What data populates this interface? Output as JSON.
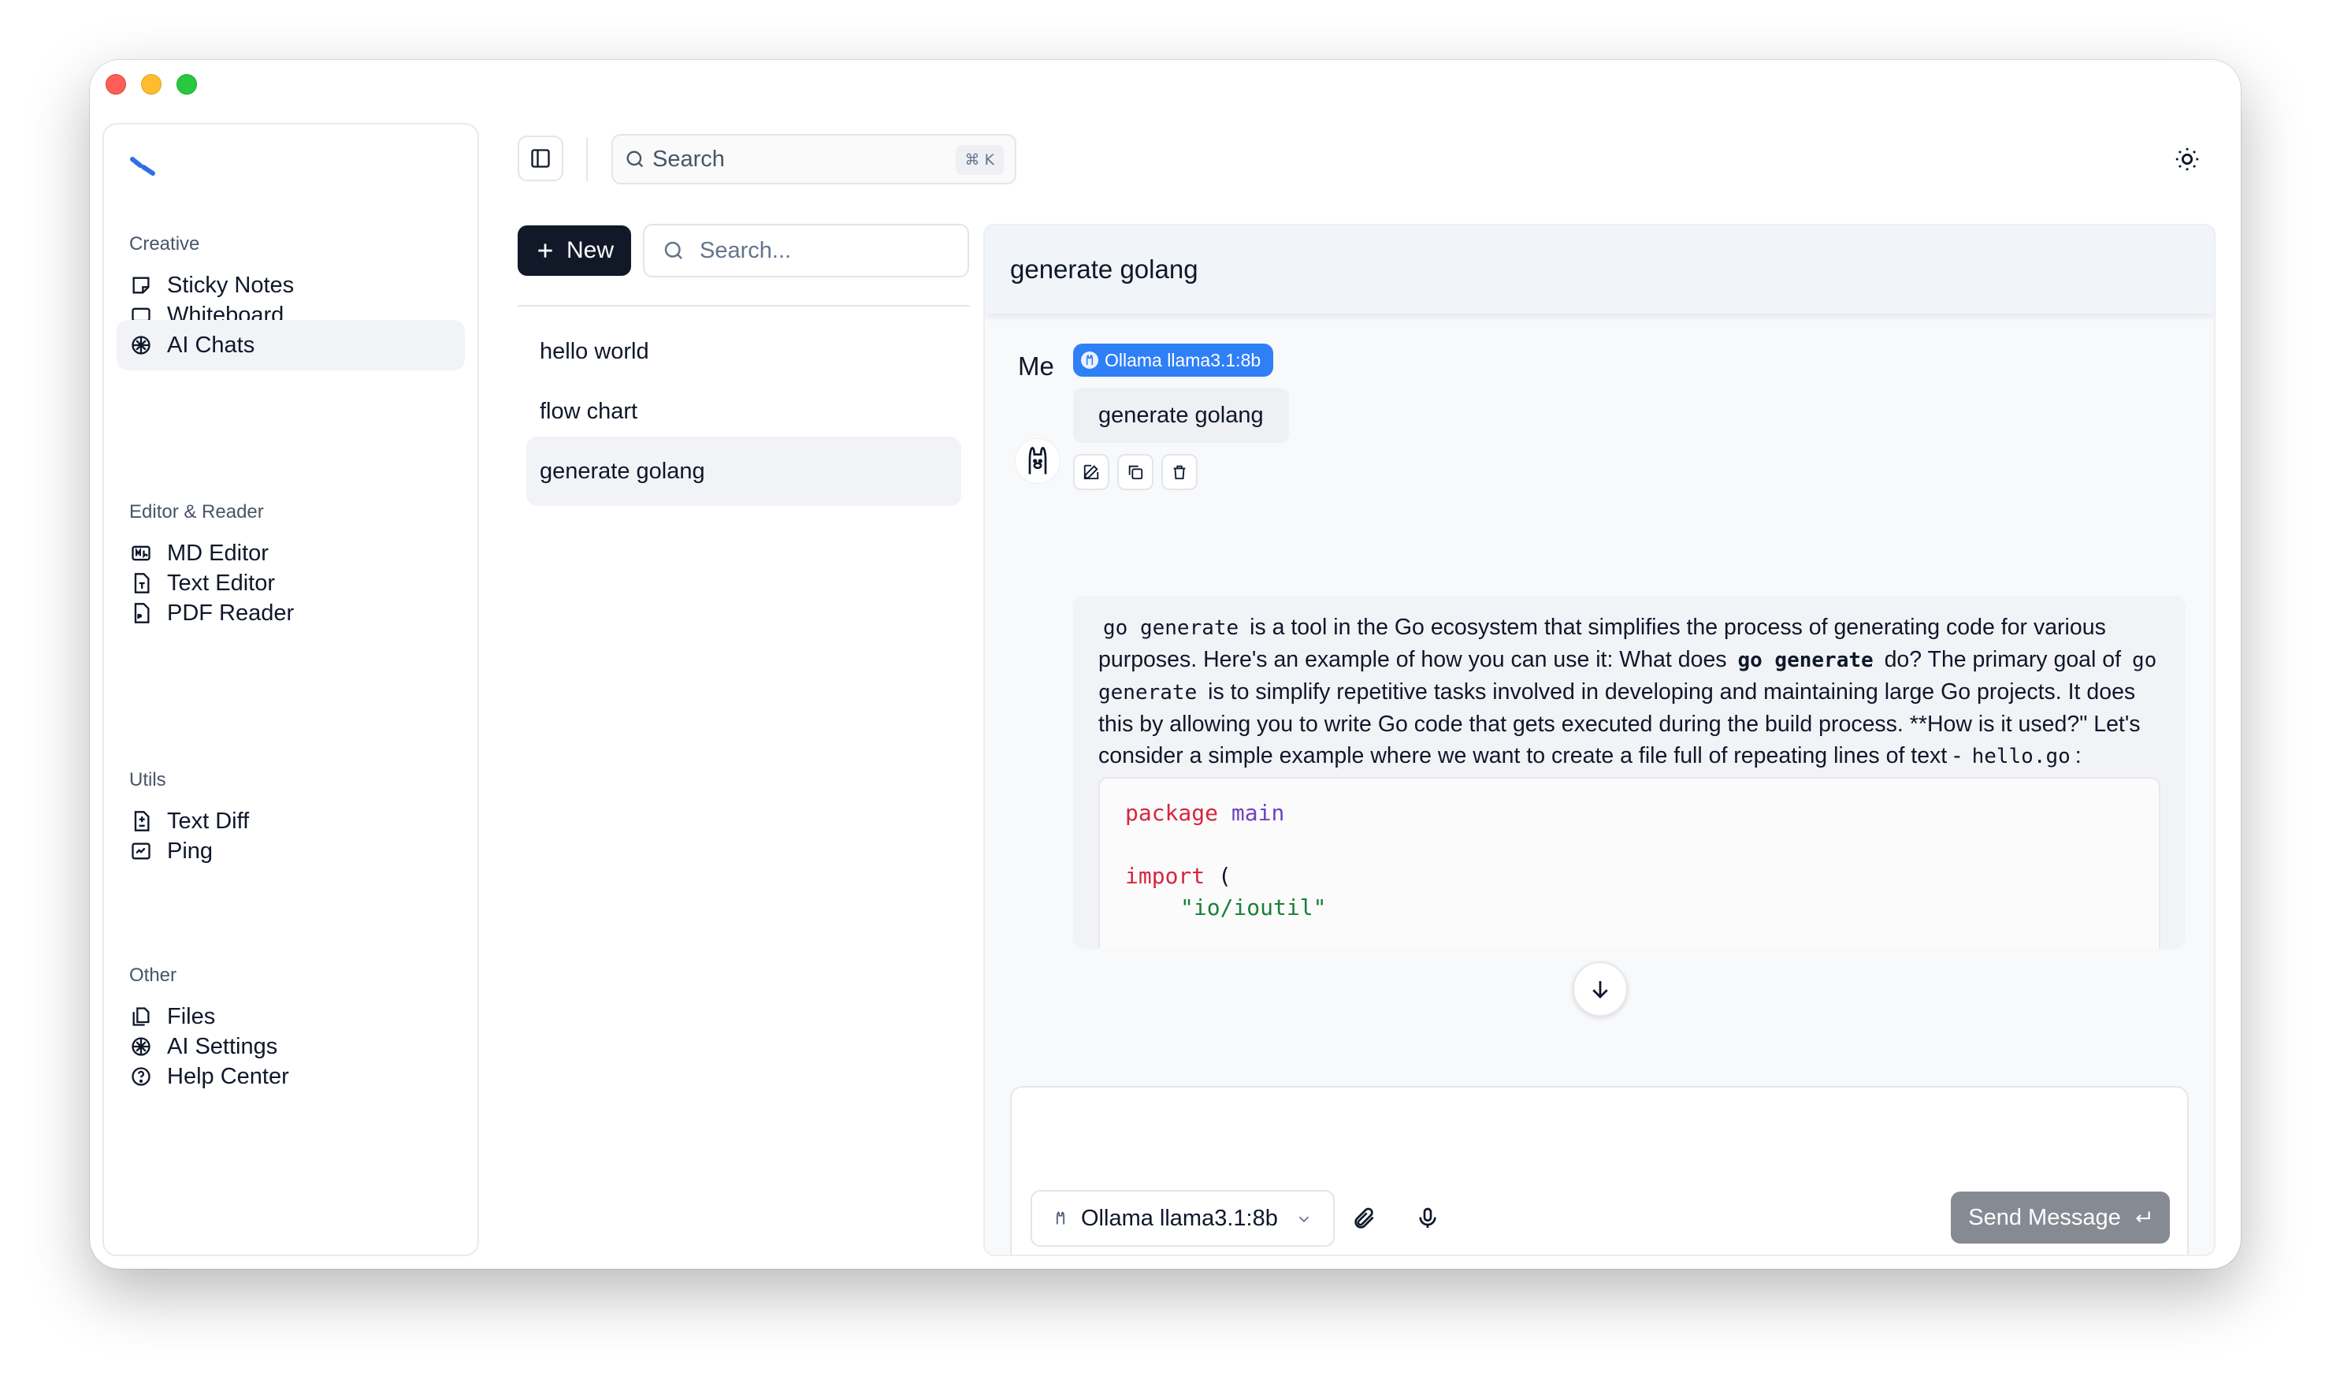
{
  "sidebar": {
    "sections": [
      {
        "label": "Creative",
        "items": [
          {
            "label": "Sticky Notes",
            "icon": "sticky-note-icon"
          },
          {
            "label": "Whiteboard",
            "icon": "whiteboard-icon"
          },
          {
            "label": "AI Chats",
            "icon": "brain-icon",
            "active": true
          }
        ]
      },
      {
        "label": "Editor & Reader",
        "items": [
          {
            "label": "MD Editor",
            "icon": "markdown-icon"
          },
          {
            "label": "Text Editor",
            "icon": "text-file-icon"
          },
          {
            "label": "PDF Reader",
            "icon": "pdf-icon"
          }
        ]
      },
      {
        "label": "Utils",
        "items": [
          {
            "label": "Text Diff",
            "icon": "diff-icon"
          },
          {
            "label": "Ping",
            "icon": "ping-icon"
          }
        ]
      },
      {
        "label": "Other",
        "items": [
          {
            "label": "Files",
            "icon": "files-icon"
          },
          {
            "label": "AI Settings",
            "icon": "brain-icon"
          },
          {
            "label": "Help Center",
            "icon": "help-icon"
          }
        ]
      }
    ]
  },
  "topbar": {
    "search_label": "Search",
    "shortcut": "⌘ K"
  },
  "chatlist": {
    "new_label": "New",
    "search_placeholder": "Search...",
    "items": [
      "hello world",
      "flow chart",
      "generate golang"
    ],
    "active_index": 2
  },
  "chat": {
    "title": "generate golang",
    "user_label": "Me",
    "model_badge": "Ollama llama3.1:8b",
    "user_message": "generate golang",
    "bot": {
      "t1": "go generate",
      "t2": " is a tool in the Go ecosystem that simplifies the process of generating code for various purposes. Here's an example of how you can use it: What does ",
      "t3": "go generate",
      "t4": " do? The primary goal of ",
      "t5": "go generate",
      "t6": " is to simplify repetitive tasks involved in developing and maintaining large Go projects. It does this by allowing you to write Go code that gets executed during the build process. **How is it used?\" Let's consider a simple example where we want to create a file full of repeating lines of text - ",
      "t7": "hello.go",
      "t8": ":",
      "code": {
        "kw_package": "package",
        "pkg_main": "main",
        "kw_import": "import",
        "paren": "(",
        "import_path": "\"io/ioutil\""
      }
    }
  },
  "composer": {
    "placeholder": "",
    "model": "Ollama llama3.1:8b",
    "send_label": "Send Message"
  },
  "colors": {
    "accent": "#2f7ff7",
    "primary_button": "#111827",
    "send_disabled": "#868b93"
  }
}
